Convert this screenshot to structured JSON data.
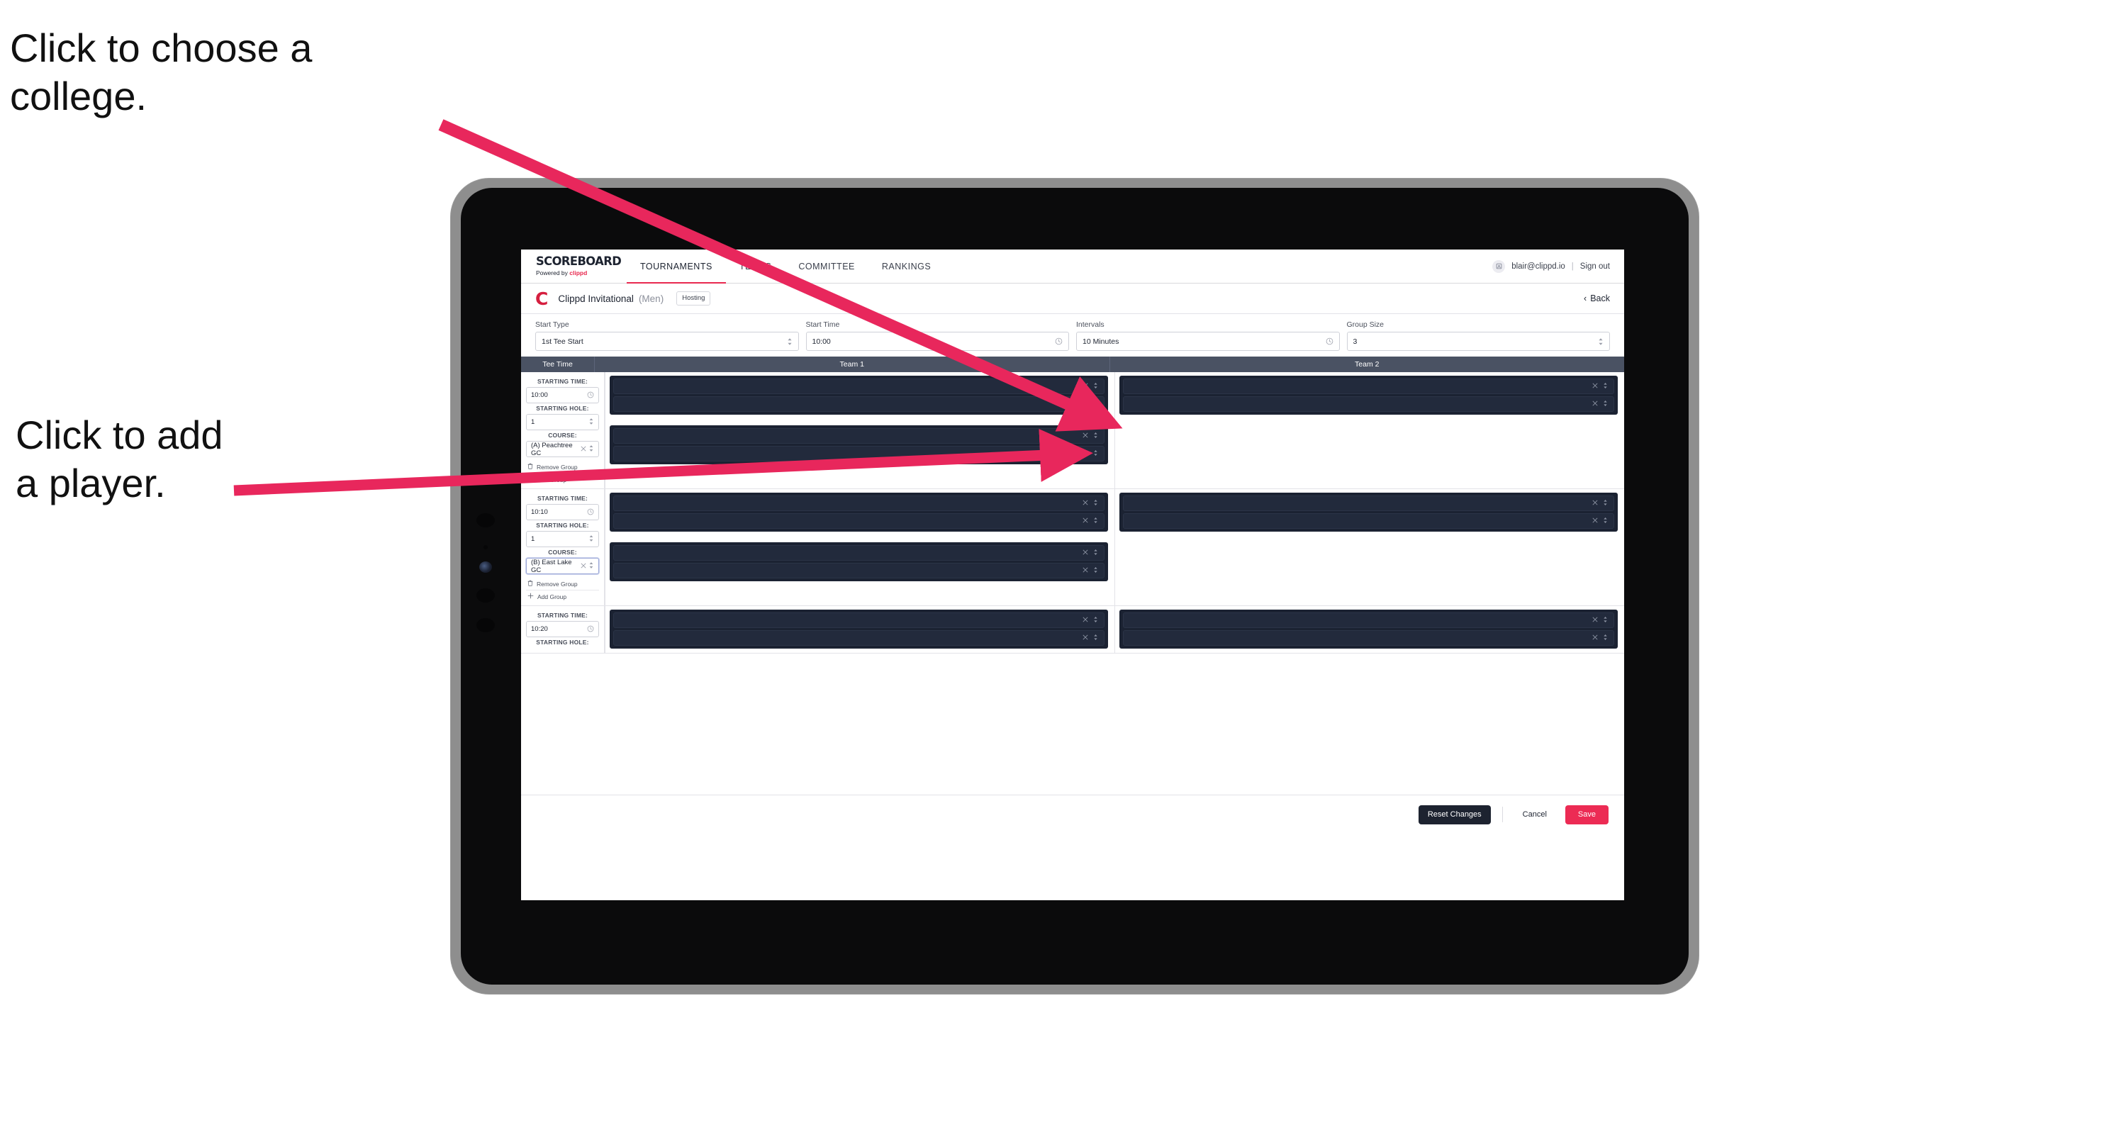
{
  "annotations": [
    {
      "id": "choose-college",
      "text": "Click to choose a\ncollege."
    },
    {
      "id": "add-player",
      "text": "Click to add\na player."
    }
  ],
  "colors": {
    "accent_pink": "#ec2b54",
    "arrow_pink": "#e8275c",
    "brand_red": "#d51f3f",
    "table_header": "#4a5263",
    "slot_dark": "#1b2232",
    "dark_button": "#1d2330"
  },
  "app": {
    "brand": {
      "word": "SCOREBOARD",
      "sub_prefix": "Powered by ",
      "sub_brand": "clippd"
    },
    "nav": {
      "tabs": [
        {
          "label": "TOURNAMENTS",
          "active": true
        },
        {
          "label": "TEAMS",
          "active": false
        },
        {
          "label": "COMMITTEE",
          "active": false
        },
        {
          "label": "RANKINGS",
          "active": false
        }
      ]
    },
    "user": {
      "avatar_icon": "user-square-icon",
      "email": "blair@clippd.io",
      "separator": "|",
      "sign_out": "Sign out"
    },
    "titlebar": {
      "logo_letter": "C",
      "tournament": "Clippd Invitational",
      "gender": "(Men)",
      "badge": "Hosting",
      "back_chevron": "‹",
      "back_label": "Back"
    },
    "form_fields": [
      {
        "label": "Start Type",
        "value": "1st Tee Start",
        "icon": "stepper-icon"
      },
      {
        "label": "Start Time",
        "value": "10:00",
        "icon": "clock-icon"
      },
      {
        "label": "Intervals",
        "value": "10 Minutes",
        "icon": "clock-icon"
      },
      {
        "label": "Group Size",
        "value": "3",
        "icon": "stepper-icon"
      }
    ],
    "table_headers": {
      "tee_time": "Tee Time",
      "team_1": "Team 1",
      "team_2": "Team 2"
    },
    "group_labels": {
      "starting_time": "STARTING TIME:",
      "starting_hole": "STARTING HOLE:",
      "course": "COURSE:",
      "remove_group": "Remove Group",
      "add_group": "Add Group",
      "remove_icon": "trash-icon",
      "add_icon": "plus-icon",
      "clear_icon": "x-icon",
      "select_icon": "chevron-updown-icon",
      "clock_icon": "clock-icon"
    },
    "groups": [
      {
        "starting_time": "10:00",
        "starting_hole": "1",
        "course": "(A) Peachtree GC",
        "course_focused": false,
        "team1_boxes": [
          {
            "slots": 2
          },
          {
            "slots": 2
          }
        ],
        "team2_boxes": [
          {
            "slots": 2
          }
        ]
      },
      {
        "starting_time": "10:10",
        "starting_hole": "1",
        "course": "(B) East Lake GC",
        "course_focused": true,
        "team1_boxes": [
          {
            "slots": 2
          },
          {
            "slots": 2
          }
        ],
        "team2_boxes": [
          {
            "slots": 2
          }
        ]
      },
      {
        "starting_time": "10:20",
        "starting_hole": "",
        "course": "",
        "course_focused": false,
        "team1_boxes": [
          {
            "slots": 2
          }
        ],
        "team2_boxes": [
          {
            "slots": 2
          }
        ]
      }
    ],
    "footer": {
      "reset": "Reset Changes",
      "cancel": "Cancel",
      "save": "Save"
    }
  }
}
